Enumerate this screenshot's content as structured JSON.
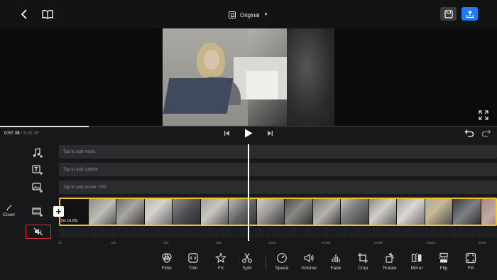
{
  "header": {
    "back_icon": "chevron-left-icon",
    "tutorial_icon": "book-icon",
    "aspect_label": "Original",
    "save_icon": "save-icon",
    "export_icon": "export-icon"
  },
  "player": {
    "current_time": "0:57.38",
    "duration": "/ 5:22.20",
    "progress": 0.179
  },
  "tracks": {
    "music": "Tap to add music",
    "subtitle": "Tap to add subtitle",
    "sticker": "Tap to add sticker / PiP",
    "clip_tag": "5m 19.20s"
  },
  "sidebar": {
    "cover_label": "Cover"
  },
  "ruler": [
    "0s",
    "16s",
    "32s",
    "48s",
    "1m4s",
    "1m20s",
    "1m36s",
    "1m52s",
    "2m8s"
  ],
  "toolbar": [
    {
      "label": "Filter",
      "icon": "filter-icon"
    },
    {
      "label": "Trim",
      "icon": "trim-icon"
    },
    {
      "label": "FX",
      "icon": "fx-icon"
    },
    {
      "label": "Split",
      "icon": "scissors-icon"
    },
    {
      "label": "Speed",
      "icon": "speed-icon"
    },
    {
      "label": "Volume",
      "icon": "volume-icon"
    },
    {
      "label": "Fade",
      "icon": "fade-icon"
    },
    {
      "label": "Crop",
      "icon": "crop-icon"
    },
    {
      "label": "Rotate",
      "icon": "rotate-icon"
    },
    {
      "label": "Mirror",
      "icon": "mirror-icon"
    },
    {
      "label": "Flip",
      "icon": "flip-icon"
    },
    {
      "label": "Fill",
      "icon": "fill-icon"
    }
  ],
  "colors": {
    "accent": "#1e7cf2",
    "clip_border": "#f2c42a",
    "highlight": "#d93030"
  }
}
